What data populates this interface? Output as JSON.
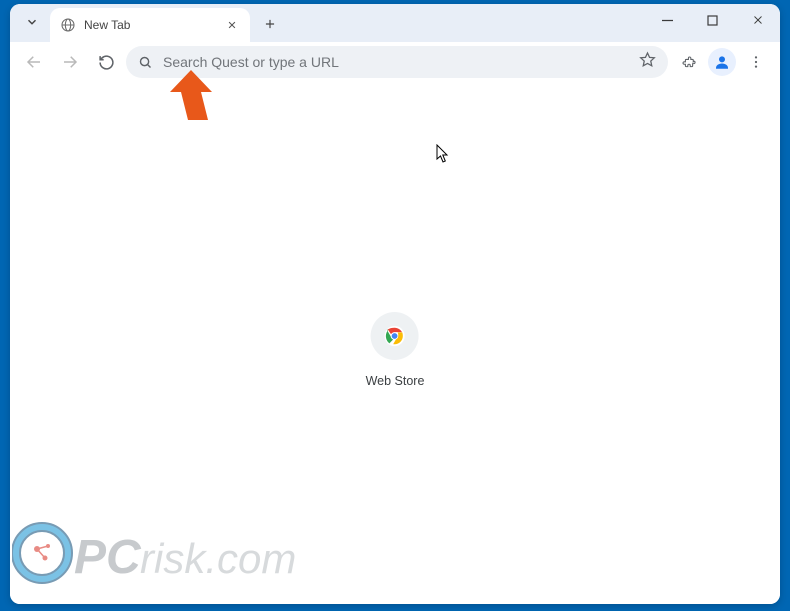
{
  "window": {
    "tab_title": "New Tab"
  },
  "omnibox": {
    "placeholder": "Search Quest or type a URL",
    "value": ""
  },
  "shortcut": {
    "label": "Web Store"
  },
  "watermark": {
    "text": "PCrisk.com"
  },
  "colors": {
    "desktop_bg": "#0066b3",
    "tabstrip_bg": "#e8eef7",
    "omnibox_bg": "#eef1f5",
    "annotation_arrow": "#e8581a"
  }
}
